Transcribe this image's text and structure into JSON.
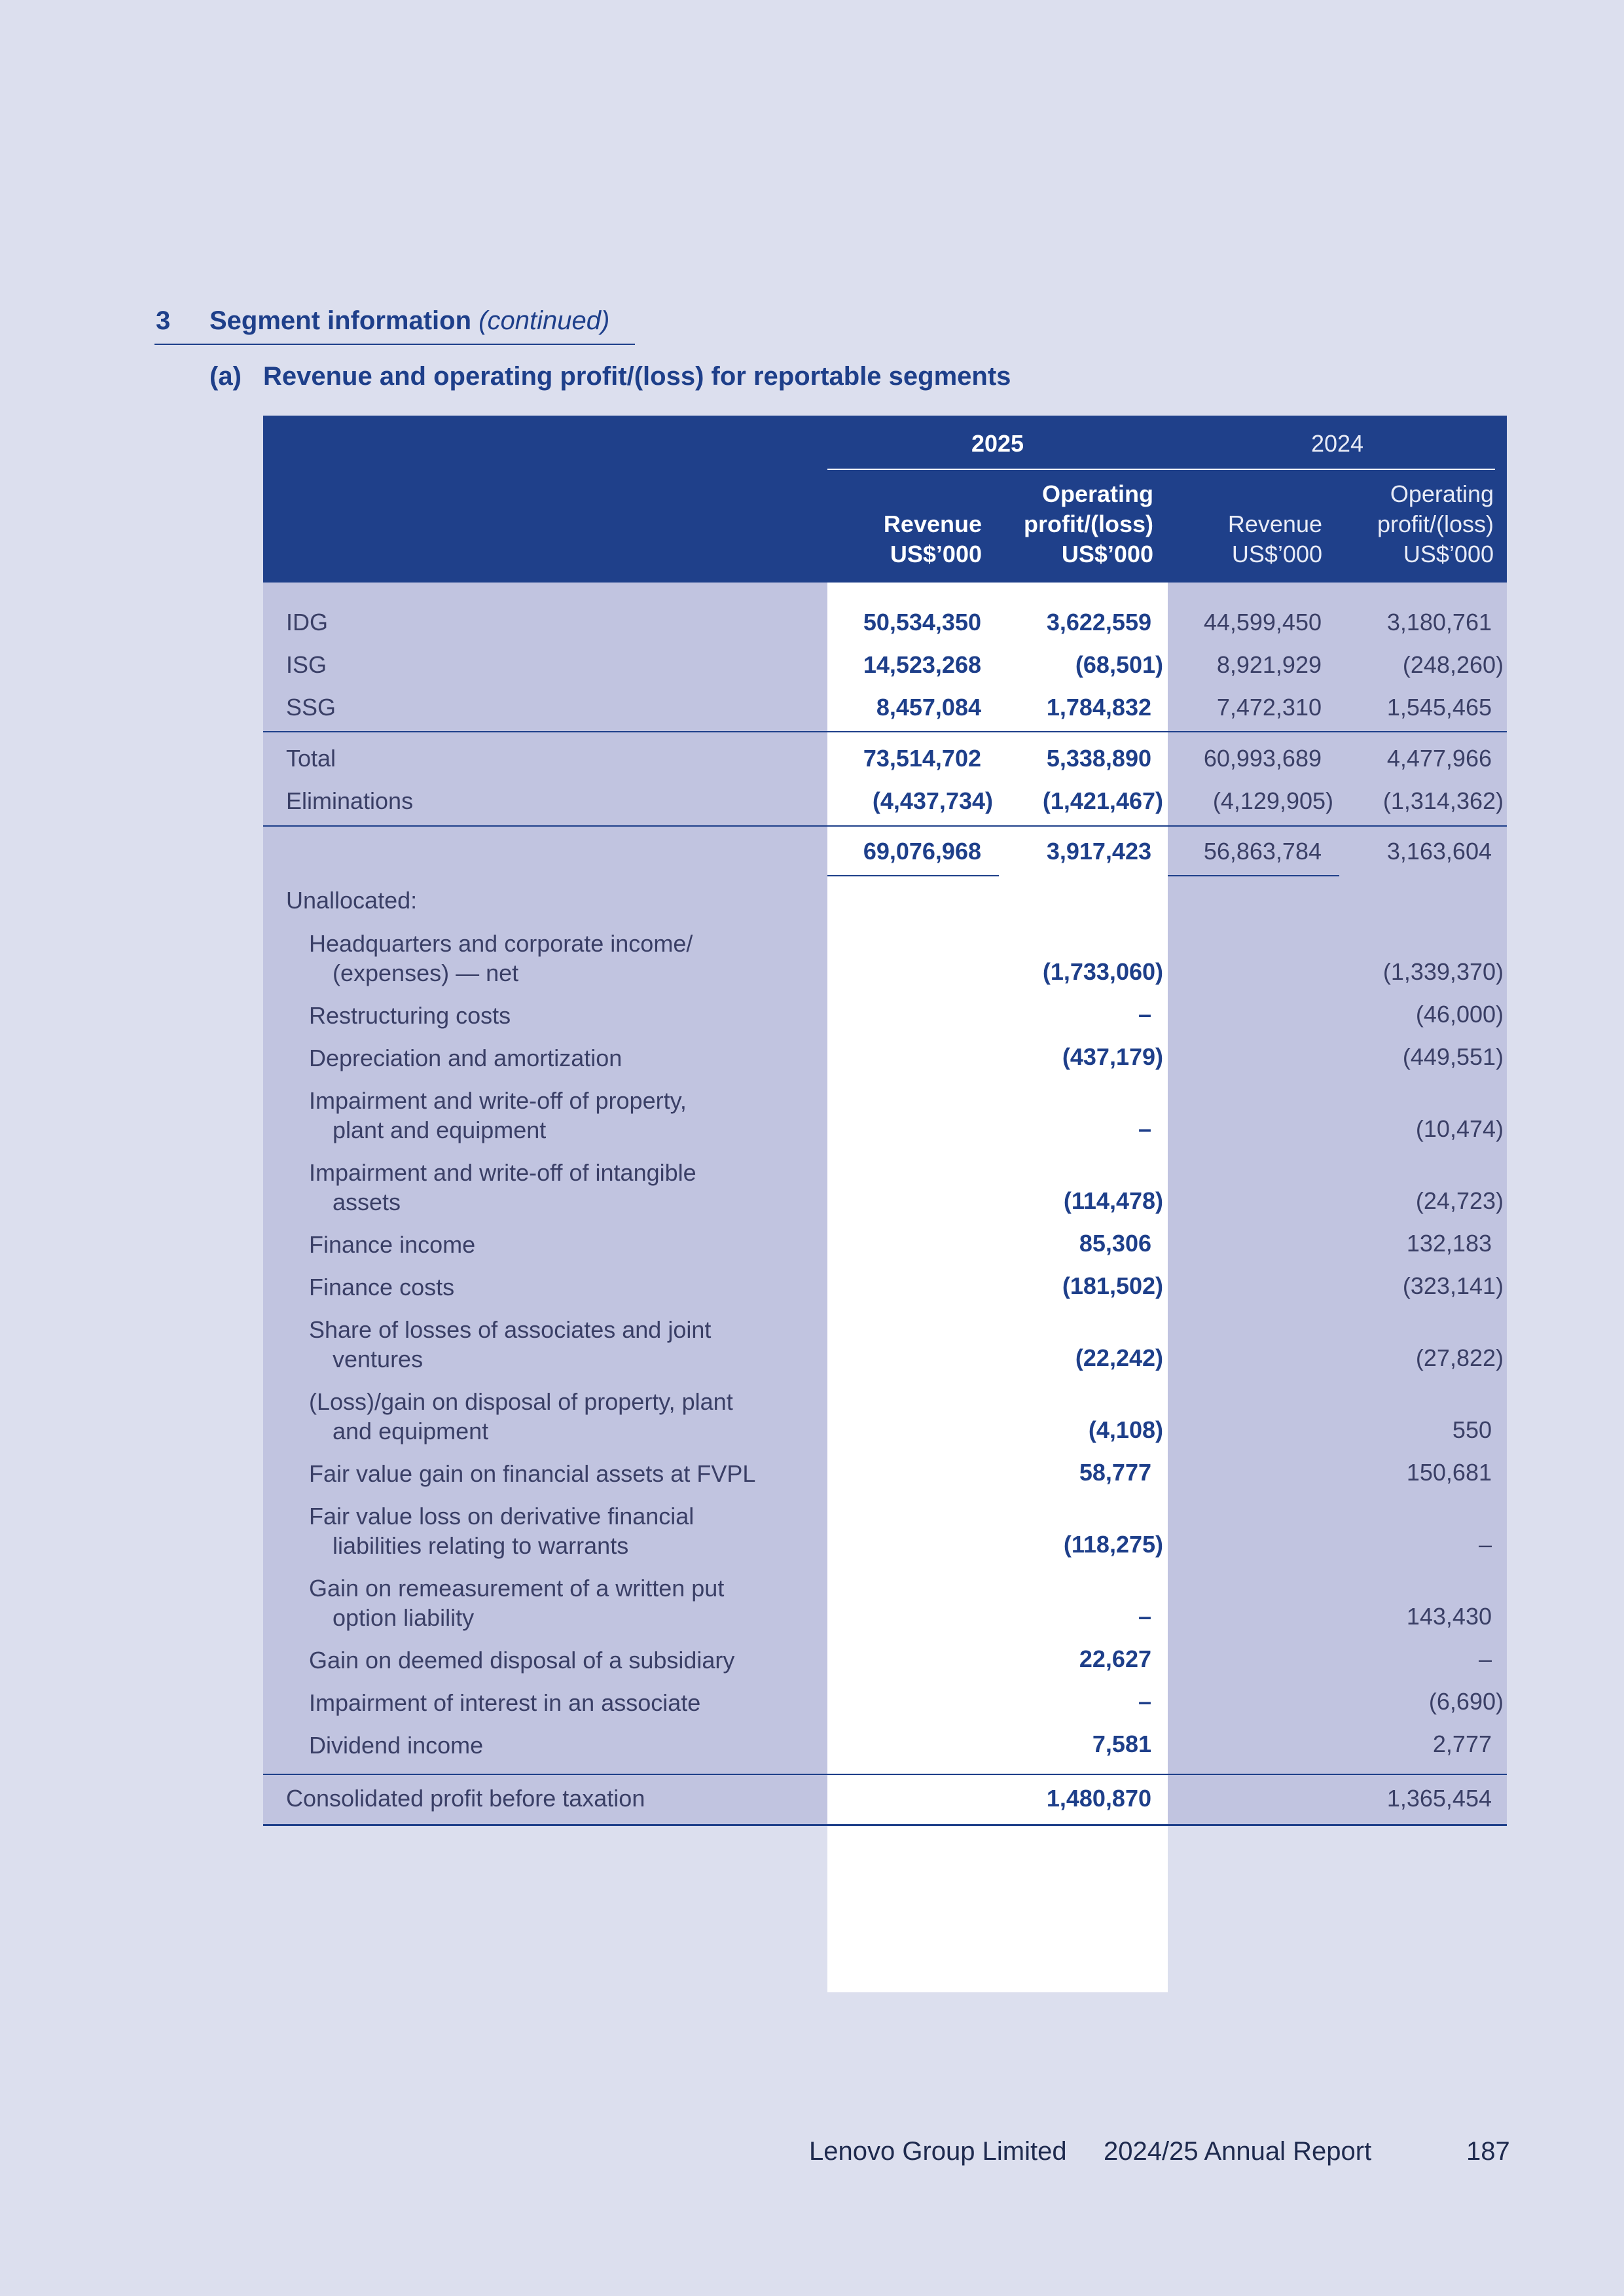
{
  "section": {
    "number": "3",
    "title": "Segment information",
    "continued": "(continued)"
  },
  "subsection": {
    "label": "(a)",
    "title": "Revenue and operating profit/(loss) for reportable segments"
  },
  "table": {
    "year_2025": "2025",
    "year_2024": "2024",
    "col_revenue_2025": [
      "Revenue",
      "US$’000"
    ],
    "col_op_2025": [
      "Operating",
      "profit/(loss)",
      "US$’000"
    ],
    "col_revenue_2024": [
      "Revenue",
      "US$’000"
    ],
    "col_op_2024": [
      "Operating",
      "profit/(loss)",
      "US$’000"
    ],
    "segments": [
      {
        "label": "IDG",
        "rev25": "50,534,350",
        "op25": "3,622,559",
        "rev24": "44,599,450",
        "op24": "3,180,761"
      },
      {
        "label": "ISG",
        "rev25": "14,523,268",
        "op25": "(68,501)",
        "rev24": "8,921,929",
        "op24": "(248,260)"
      },
      {
        "label": "SSG",
        "rev25": "8,457,084",
        "op25": "1,784,832",
        "rev24": "7,472,310",
        "op24": "1,545,465"
      }
    ],
    "total": {
      "label": "Total",
      "rev25": "73,514,702",
      "op25": "5,338,890",
      "rev24": "60,993,689",
      "op24": "4,477,966"
    },
    "eliminations": {
      "label": "Eliminations",
      "rev25": "(4,437,734)",
      "op25": "(1,421,467)",
      "rev24": "(4,129,905)",
      "op24": "(1,314,362)"
    },
    "subtotal": {
      "rev25": "69,076,968",
      "op25": "3,917,423",
      "rev24": "56,863,784",
      "op24": "3,163,604"
    },
    "unallocated_label": "Unallocated:",
    "unallocated": [
      {
        "line1": "Headquarters and corporate income/",
        "line2": "(expenses) — net",
        "op25": "(1,733,060)",
        "op24": "(1,339,370)"
      },
      {
        "line1": "Restructuring costs",
        "op25": "–",
        "op24": "(46,000)"
      },
      {
        "line1": "Depreciation and amortization",
        "op25": "(437,179)",
        "op24": "(449,551)"
      },
      {
        "line1": "Impairment and write-off of property,",
        "line2": "plant and equipment",
        "op25": "–",
        "op24": "(10,474)"
      },
      {
        "line1": "Impairment and write-off of intangible",
        "line2": "assets",
        "op25": "(114,478)",
        "op24": "(24,723)"
      },
      {
        "line1": "Finance income",
        "op25": "85,306",
        "op24": "132,183"
      },
      {
        "line1": "Finance costs",
        "op25": "(181,502)",
        "op24": "(323,141)"
      },
      {
        "line1": "Share of losses of associates and joint",
        "line2": "ventures",
        "op25": "(22,242)",
        "op24": "(27,822)"
      },
      {
        "line1": "(Loss)/gain on disposal of property, plant",
        "line2": "and equipment",
        "op25": "(4,108)",
        "op24": "550"
      },
      {
        "line1": "Fair value gain on financial assets at FVPL",
        "op25": "58,777",
        "op24": "150,681"
      },
      {
        "line1": "Fair value loss on derivative financial",
        "line2": "liabilities relating to warrants",
        "op25": "(118,275)",
        "op24": "–"
      },
      {
        "line1": "Gain on remeasurement of a written put",
        "line2": "option liability",
        "op25": "–",
        "op24": "143,430"
      },
      {
        "line1": "Gain on deemed disposal of a subsidiary",
        "op25": "22,627",
        "op24": "–"
      },
      {
        "line1": "Impairment of interest in an associate",
        "op25": "–",
        "op24": "(6,690)"
      },
      {
        "line1": "Dividend income",
        "op25": "7,581",
        "op24": "2,777"
      }
    ],
    "consolidated": {
      "label": "Consolidated profit before taxation",
      "op25": "1,480,870",
      "op24": "1,365,454"
    }
  },
  "footer": {
    "company": "Lenovo Group Limited",
    "report": "2024/25 Annual Report",
    "page": "187"
  }
}
